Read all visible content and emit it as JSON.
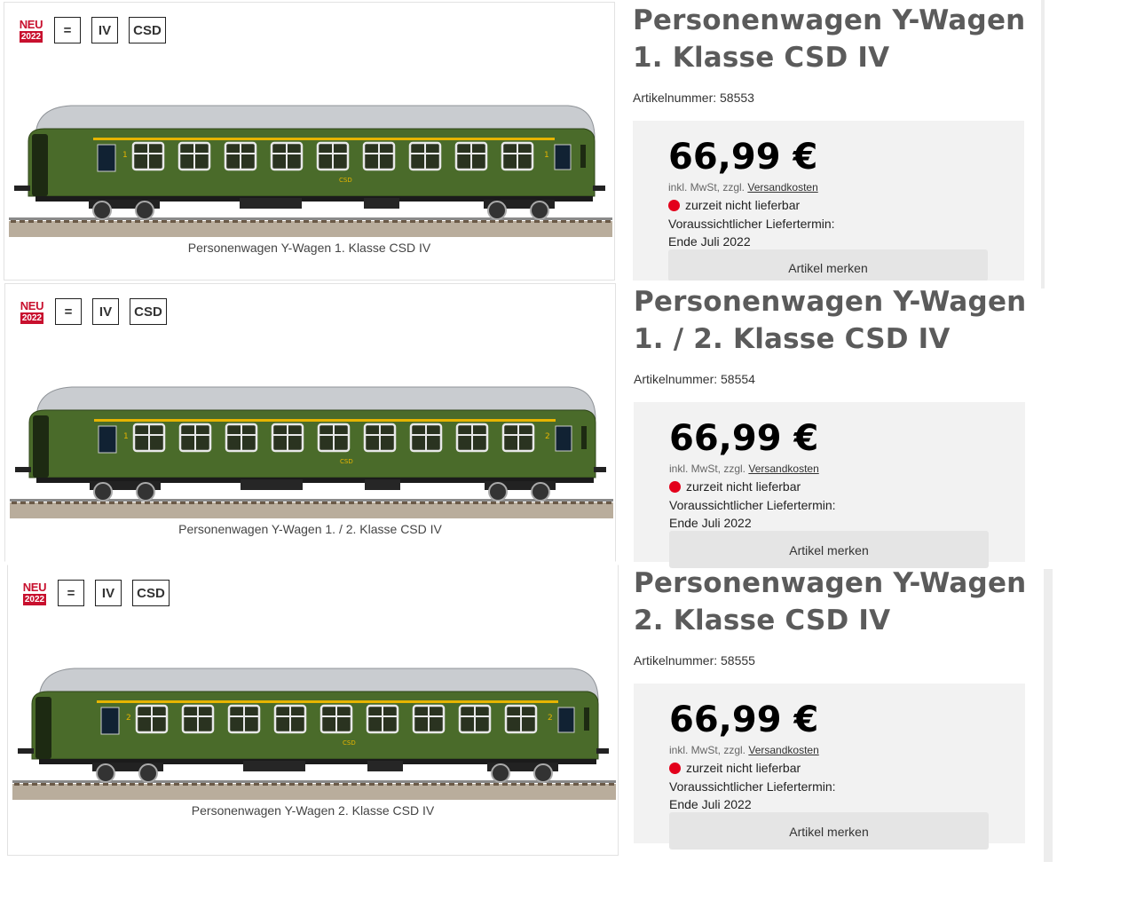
{
  "products": [
    {
      "badges": {
        "neu": "NEU",
        "year": "2022",
        "system": "=",
        "epoch": "IV",
        "railway": "CSD"
      },
      "title": "Personenwagen Y-Wagen 1. Klasse CSD IV",
      "caption": "Personenwagen Y-Wagen 1. Klasse CSD IV",
      "artikel_label": "Artikelnummer: 58553",
      "price": "66,99 €",
      "tax_prefix": "inkl. MwSt, zzgl.",
      "shipping_link": "Versandkosten",
      "availability": "zurzeit nicht lieferbar",
      "delivery_label": "Voraussichtlicher Liefertermin:",
      "delivery_date": "Ende Juli 2022",
      "merken_label": "Artikel merken",
      "car_digits": [
        "1",
        "1"
      ]
    },
    {
      "badges": {
        "neu": "NEU",
        "year": "2022",
        "system": "=",
        "epoch": "IV",
        "railway": "CSD"
      },
      "title": "Personenwagen Y-Wagen 1. / 2. Klasse CSD IV",
      "caption": "Personenwagen Y-Wagen 1. / 2. Klasse CSD IV",
      "artikel_label": "Artikelnummer: 58554",
      "price": "66,99 €",
      "tax_prefix": "inkl. MwSt, zzgl.",
      "shipping_link": "Versandkosten",
      "availability": "zurzeit nicht lieferbar",
      "delivery_label": "Voraussichtlicher Liefertermin:",
      "delivery_date": "Ende Juli 2022",
      "merken_label": "Artikel merken",
      "car_digits": [
        "1",
        "2"
      ]
    },
    {
      "badges": {
        "neu": "NEU",
        "year": "2022",
        "system": "=",
        "epoch": "IV",
        "railway": "CSD"
      },
      "title": "Personenwagen Y-Wagen 2. Klasse CSD IV",
      "caption": "Personenwagen Y-Wagen 2. Klasse CSD IV",
      "artikel_label": "Artikelnummer: 58555",
      "price": "66,99 €",
      "tax_prefix": "inkl. MwSt, zzgl.",
      "shipping_link": "Versandkosten",
      "availability": "zurzeit nicht lieferbar",
      "delivery_label": "Voraussichtlicher Liefertermin:",
      "delivery_date": "Ende Juli 2022",
      "merken_label": "Artikel merken",
      "car_digits": [
        "2",
        "2"
      ]
    }
  ],
  "car_lettering": "CSD",
  "colors": {
    "body_green": "#4a6b2a",
    "roof_grey": "#c9ccd0",
    "stripe_yellow": "#e6b400",
    "availability_red": "#e3001b",
    "badge_red": "#c8102e",
    "buybox_bg": "#f2f2f2"
  },
  "icons": {
    "new_badge": "neu-2022-badge",
    "dc_system": "dc-current-icon",
    "availability": "red-dot-icon"
  }
}
